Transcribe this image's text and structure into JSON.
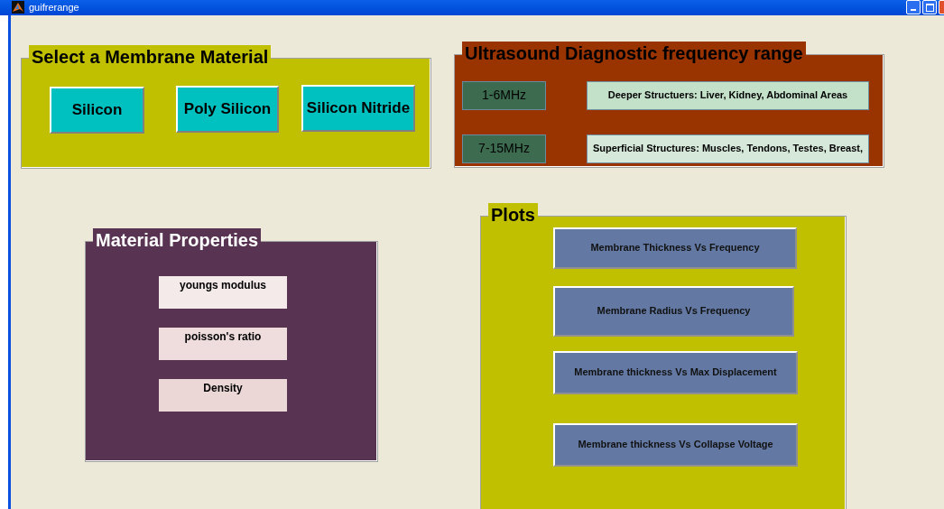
{
  "window": {
    "title": "guifrerange"
  },
  "material_panel": {
    "title": "Select a Membrane Material",
    "buttons": [
      "Silicon",
      "Poly Silicon",
      "Silicon Nitride"
    ]
  },
  "frequency_panel": {
    "title": "Ultrasound Diagnostic frequency range",
    "rows": [
      {
        "range": "1-6MHz",
        "description": "Deeper Structuers: Liver, Kidney, Abdominal Areas"
      },
      {
        "range": "7-15MHz",
        "description": "Superficial Structures: Muscles, Tendons, Testes, Breast,"
      }
    ]
  },
  "properties_panel": {
    "title": "Material Properties",
    "fields": [
      "youngs modulus",
      "poisson's ratio",
      "Density"
    ]
  },
  "plots_panel": {
    "title": "Plots",
    "buttons": [
      "Membrane Thickness Vs Frequency",
      "Membrane Radius Vs Frequency",
      "Membrane thickness Vs Max Displacement",
      "Membrane thickness Vs Collapse Voltage"
    ]
  }
}
